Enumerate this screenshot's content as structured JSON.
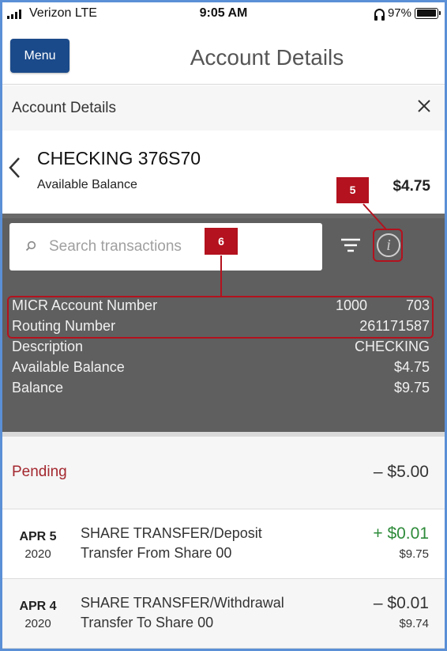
{
  "status_bar": {
    "carrier": "Verizon  LTE",
    "time": "9:05 AM",
    "battery": "97%"
  },
  "header": {
    "menu_label": "Menu",
    "title": "Account Details"
  },
  "subheader": {
    "title": "Account Details"
  },
  "account": {
    "name": "CHECKING 376S70",
    "available_label": "Available Balance",
    "available_value": "$4.75"
  },
  "search": {
    "placeholder": "Search transactions"
  },
  "details": {
    "micr_label": "MICR Account Number",
    "micr_part1": "1000",
    "micr_part2": "703",
    "routing_label": "Routing Number",
    "routing_value": "261171587",
    "description_label": "Description",
    "description_value": "CHECKING",
    "available_label": "Available Balance",
    "available_value": "$4.75",
    "balance_label": "Balance",
    "balance_value": "$9.75"
  },
  "annotations": {
    "badge_5": "5",
    "badge_6": "6",
    "color": "#b3121e"
  },
  "pending": {
    "label": "Pending",
    "amount": "– $5.00"
  },
  "transactions": [
    {
      "month": "APR 5",
      "year": "2020",
      "line1": "SHARE TRANSFER/Deposit",
      "line2": "Transfer From Share 00",
      "amount": "+ $0.01",
      "balance": "$9.75"
    },
    {
      "month": "APR 4",
      "year": "2020",
      "line1": "SHARE TRANSFER/Withdrawal",
      "line2": "Transfer To Share 00",
      "amount": "– $0.01",
      "balance": "$9.74"
    }
  ],
  "colors": {
    "menu_button": "#1b4a8a",
    "pending_label": "#a3282f",
    "credit_amount": "#2e8b3a",
    "panel_bg": "#5f5f5f"
  }
}
